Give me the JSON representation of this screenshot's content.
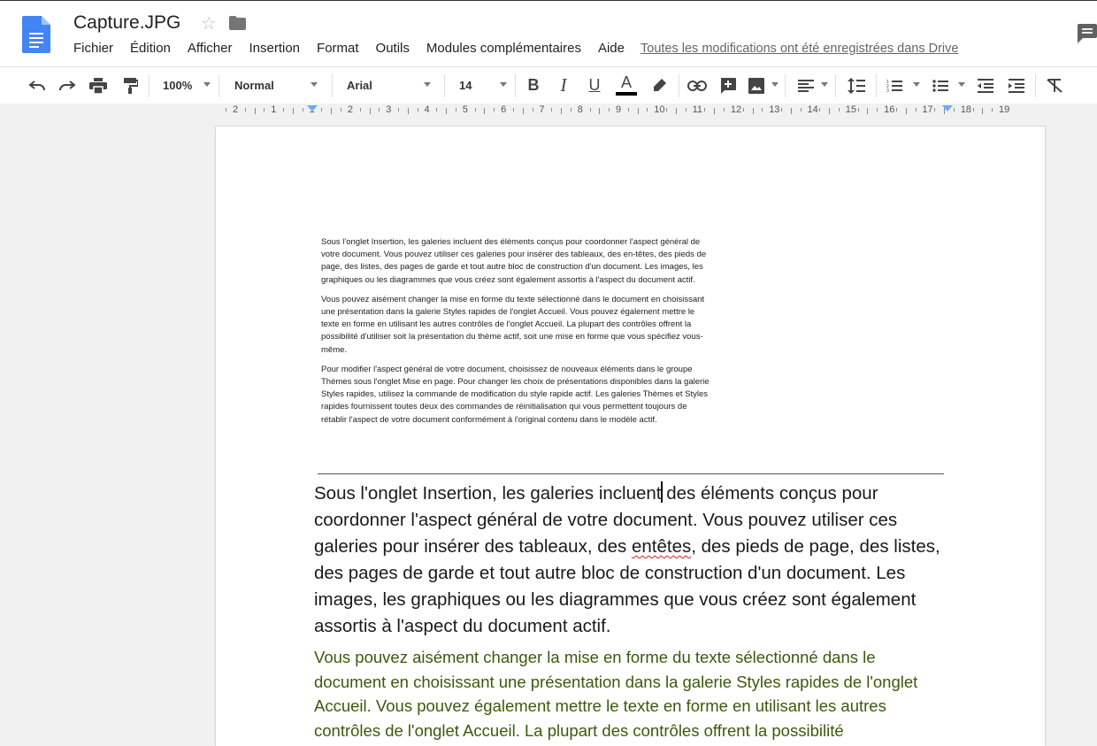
{
  "header": {
    "title": "Capture.JPG",
    "menu": [
      "Fichier",
      "Édition",
      "Afficher",
      "Insertion",
      "Format",
      "Outils",
      "Modules complémentaires",
      "Aide"
    ],
    "save_status": "Toutes les modifications ont été enregistrées dans Drive"
  },
  "toolbar": {
    "zoom": "100%",
    "style": "Normal",
    "font": "Arial",
    "font_size": "14",
    "bold": "B",
    "italic": "I",
    "underline": "U",
    "text_color": "A",
    "icons": [
      "undo-icon",
      "redo-icon",
      "print-icon",
      "paint-format-icon",
      "link-icon",
      "add-comment-icon",
      "image-icon",
      "align-left-icon",
      "line-spacing-icon",
      "numbered-list-icon",
      "bulleted-list-icon",
      "decrease-indent-icon",
      "increase-indent-icon",
      "clear-formatting-icon"
    ]
  },
  "ruler": {
    "labels": [
      "2",
      "1",
      "1",
      "2",
      "3",
      "4",
      "5",
      "6",
      "7",
      "8",
      "9",
      "10",
      "11",
      "12",
      "13",
      "14",
      "15",
      "16",
      "17",
      "18",
      "19"
    ]
  },
  "document": {
    "small_paragraphs": [
      "Sous l'onglet Insertion, les galeries incluent des éléments conçus pour coordonner l'aspect général de votre document. Vous pouvez utiliser ces galeries pour insérer des tableaux, des en-têtes, des pieds de page, des listes, des pages de garde et tout autre bloc de construction d'un document. Les images, les graphiques ou les diagrammes que vous créez sont également assortis à l'aspect du document actif.",
      "Vous pouvez aisément changer la mise en forme du texte sélectionné dans le document en choisissant une présentation dans la galerie Styles rapides de l'onglet Accueil. Vous pouvez également mettre le texte en forme en utilisant les autres contrôles de l'onglet Accueil. La plupart des contrôles offrent la possibilité d'utiliser soit la présentation du thème actif, soit une mise en forme que vous spécifiez vous-même.",
      "Pour modifier l'aspect général de votre document, choisissez de nouveaux éléments dans le groupe Thèmes sous l'onglet Mise en page. Pour changer les choix de présentations disponibles dans la galerie Styles rapides, utilisez la commande de modification du style rapide actif. Les galeries Thèmes et Styles rapides fournissent toutes deux des commandes de réinitialisation qui vous permettent toujours de rétablir l'aspect de votre document conformément à l'original contenu dans le modèle actif."
    ],
    "big_p1_before_cursor": "Sous l'onglet Insertion, les galeries incluent",
    "big_p1_after_cursor": " des éléments conçus pour coordonner l'aspect général de votre document. Vous pouvez utiliser ces galeries pour insérer des tableaux, des ",
    "big_p1_misspelled": "entêtes",
    "big_p1_end": ", des pieds de page, des listes, des pages de garde et tout autre bloc de construction d'un document. Les images, les graphiques ou les diagrammes que vous créez sont également assortis à l'aspect du document actif.",
    "big_p2": "Vous pouvez aisément changer la mise en forme du texte sélectionné dans le document en choisissant une présentation dans la galerie Styles rapides de l'onglet Accueil. Vous pouvez également mettre le texte en forme en utilisant les autres contrôles de l'onglet Accueil. La plupart des contrôles offrent la possibilité",
    "big_p2_color": "#3b5a0a"
  }
}
